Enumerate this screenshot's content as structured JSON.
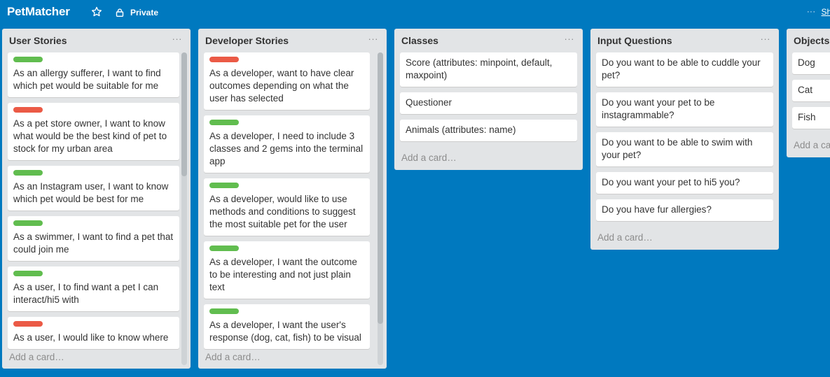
{
  "board": {
    "title": "PetMatcher",
    "visibility": "Private",
    "show_menu_label": "Sh"
  },
  "lists": [
    {
      "title": "User Stories",
      "menu": "···",
      "add_card": "Add a card…",
      "cards": [
        {
          "label": "green",
          "text": "As an allergy sufferer, I want to find which pet would be suitable for me"
        },
        {
          "label": "red",
          "text": "As a pet store owner, I want to know what would be the best kind of pet to stock for my urban area"
        },
        {
          "label": "green",
          "text": "As an Instagram user, I want to know which pet would be best for me"
        },
        {
          "label": "green",
          "text": "As a swimmer, I want to find a pet that could join me"
        },
        {
          "label": "green",
          "text": "As a user, I to find want a pet I can interact/hi5 with"
        },
        {
          "label": "red",
          "text": "As a user, I would like to know where"
        }
      ]
    },
    {
      "title": "Developer Stories",
      "menu": "···",
      "add_card": "Add a card…",
      "cards": [
        {
          "label": "red",
          "text": "As a developer, want to have clear outcomes depending on what the user has selected"
        },
        {
          "label": "green",
          "text": "As a developer, I need to include 3 classes and 2 gems into the terminal app"
        },
        {
          "label": "green",
          "text": "As a developer, would like to use methods and conditions to suggest the most suitable pet for the user"
        },
        {
          "label": "green",
          "text": "As a developer, I want the outcome to be interesting and not just plain text"
        },
        {
          "label": "green",
          "text": "As a developer, I want the user's response (dog, cat, fish) to be visual"
        }
      ]
    },
    {
      "title": "Classes",
      "menu": "···",
      "add_card": "Add a card…",
      "cards": [
        {
          "label": "",
          "text": "Score (attributes: minpoint, default, maxpoint)"
        },
        {
          "label": "",
          "text": "Questioner"
        },
        {
          "label": "",
          "text": "Animals (attributes: name)"
        }
      ]
    },
    {
      "title": "Input Questions",
      "menu": "···",
      "add_card": "Add a card…",
      "cards": [
        {
          "label": "",
          "text": "Do you want to be able to cuddle your pet?"
        },
        {
          "label": "",
          "text": "Do you want your pet to be instagrammable?"
        },
        {
          "label": "",
          "text": "Do you want to be able to swim with your pet?"
        },
        {
          "label": "",
          "text": "Do you want your pet to hi5 you?"
        },
        {
          "label": "",
          "text": "Do you have fur allergies?"
        }
      ]
    },
    {
      "title": "Objects",
      "menu": "",
      "add_card": "Add a card…",
      "cards": [
        {
          "label": "",
          "text": "Dog"
        },
        {
          "label": "",
          "text": "Cat"
        },
        {
          "label": "",
          "text": "Fish"
        }
      ]
    }
  ],
  "colors": {
    "board_background": "#0079bf",
    "list_background": "#e2e4e6",
    "label_green": "#61bd4f",
    "label_red": "#eb5a46"
  }
}
